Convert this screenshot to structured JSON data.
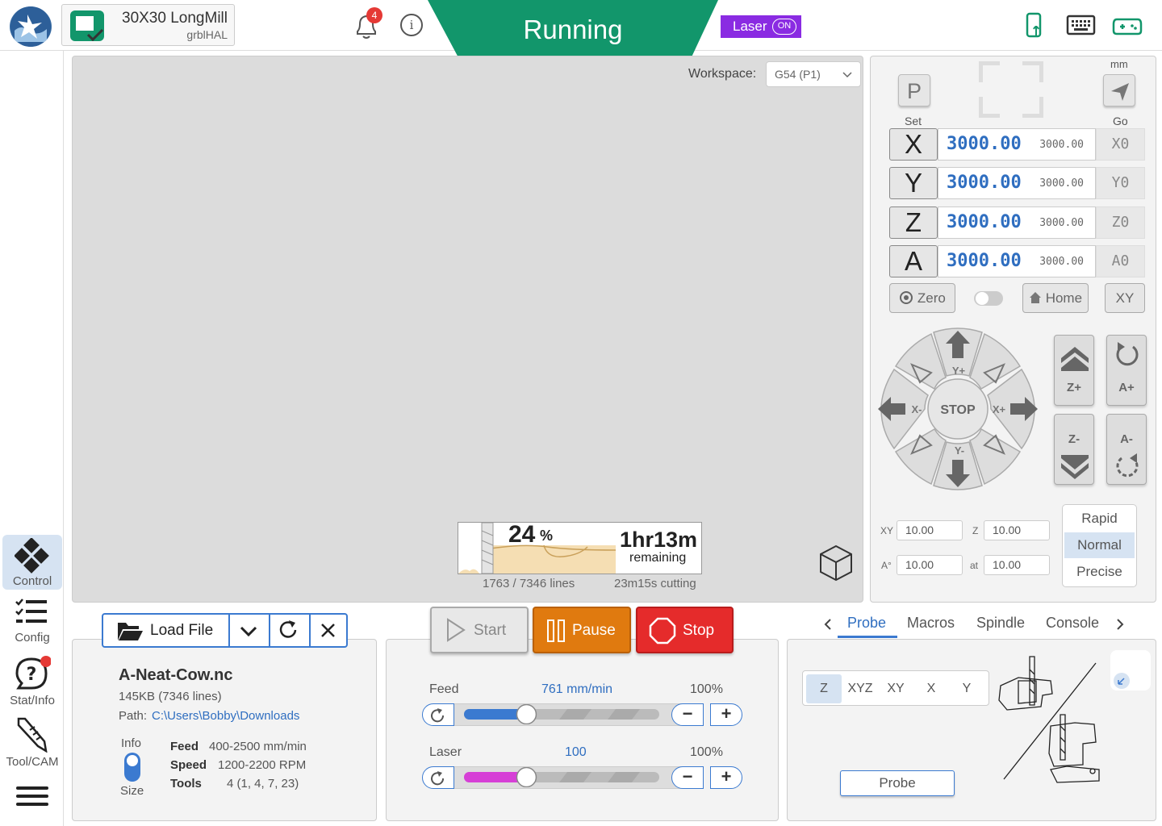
{
  "machine": {
    "name": "30X30 LongMill",
    "firmware": "grblHAL"
  },
  "notifications": {
    "count": "4"
  },
  "status": {
    "text": "Running",
    "color": "#12966b"
  },
  "laser": {
    "label": "Laser",
    "state": "ON"
  },
  "sidebar": {
    "items": [
      {
        "label": "Control",
        "icon": "control-icon",
        "active": true
      },
      {
        "label": "Config",
        "icon": "checklist-icon"
      },
      {
        "label": "Stat/Info",
        "icon": "help-chat-icon"
      },
      {
        "label": "Tool/CAM",
        "icon": "endmill-icon"
      }
    ]
  },
  "visualizer": {
    "workspace_label": "Workspace:",
    "workspace_value": "G54 (P1)",
    "progress_percent": "24",
    "progress_sign": "%",
    "remaining_time": "1hr13m",
    "remaining_label": "remaining",
    "lines": "1763 / 7346 lines",
    "cutting": "23m15s cutting"
  },
  "dro": {
    "units": "mm",
    "set_label": "Set",
    "set_button": "P",
    "go_label": "Go",
    "axes": [
      {
        "letter": "X",
        "work": "3000.00",
        "machine": "3000.00",
        "zero": "X0"
      },
      {
        "letter": "Y",
        "work": "3000.00",
        "machine": "3000.00",
        "zero": "Y0"
      },
      {
        "letter": "Z",
        "work": "3000.00",
        "machine": "3000.00",
        "zero": "Z0"
      },
      {
        "letter": "A",
        "work": "3000.00",
        "machine": "3000.00",
        "zero": "A0"
      }
    ],
    "zero_button": "Zero",
    "home_button": "Home",
    "xy_button": "XY"
  },
  "jog": {
    "labels": {
      "yplus": "Y+",
      "yminus": "Y-",
      "xplus": "X+",
      "xminus": "X-",
      "stop": "STOP",
      "zplus": "Z+",
      "zminus": "Z-",
      "aplus": "A+",
      "aminus": "A-"
    },
    "inputs": [
      {
        "label": "XY",
        "value": "10.00"
      },
      {
        "label": "Z",
        "value": "10.00"
      },
      {
        "label": "A°",
        "value": "10.00"
      },
      {
        "label": "at",
        "value": "10.00"
      }
    ],
    "speeds": [
      "Rapid",
      "Normal",
      "Precise"
    ],
    "selected_speed": "Normal"
  },
  "file": {
    "load_label": "Load File",
    "name": "A-Neat-Cow.nc",
    "size": "145KB (7346 lines)",
    "path_label": "Path:",
    "path": "C:\\Users\\Bobby\\Downloads",
    "info_label": "Info",
    "size_label": "Size",
    "stats": [
      {
        "key": "Feed",
        "value": "400-2500 mm/min"
      },
      {
        "key": "Speed",
        "value": "1200-2200 RPM"
      },
      {
        "key": "Tools",
        "value": "4 (1, 4, 7, 23)"
      }
    ]
  },
  "run": {
    "start": "Start",
    "pause": "Pause",
    "stop": "Stop"
  },
  "overrides": {
    "feed": {
      "label": "Feed",
      "value": "761 mm/min",
      "percent": "100%",
      "fill": 0.32,
      "color": "#3b7ad0"
    },
    "laser": {
      "label": "Laser",
      "value": "100",
      "percent": "100%",
      "fill": 0.32,
      "color": "#d63fd6"
    }
  },
  "tabs": {
    "items": [
      "Probe",
      "Macros",
      "Spindle",
      "Console"
    ],
    "active": "Probe"
  },
  "probe": {
    "axes": [
      "Z",
      "XYZ",
      "XY",
      "X",
      "Y"
    ],
    "selected_axis": "Z",
    "button": "Probe"
  }
}
